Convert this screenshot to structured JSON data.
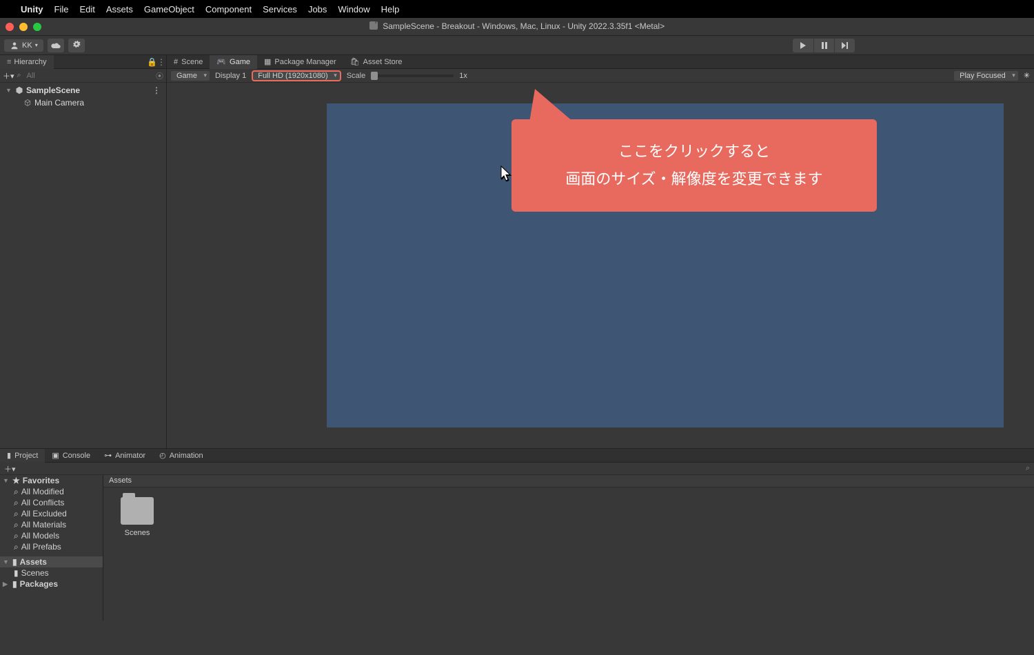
{
  "menubar": {
    "app": "Unity",
    "items": [
      "File",
      "Edit",
      "Assets",
      "GameObject",
      "Component",
      "Services",
      "Jobs",
      "Window",
      "Help"
    ]
  },
  "titlebar": {
    "title": "SampleScene - Breakout - Windows, Mac, Linux - Unity 2022.3.35f1 <Metal>"
  },
  "toolbar": {
    "account": "KK"
  },
  "hierarchy": {
    "tab_label": "Hierarchy",
    "search_placeholder": "All",
    "root": "SampleScene",
    "children": [
      "Main Camera"
    ]
  },
  "game_tabs": {
    "scene": "Scene",
    "game": "Game",
    "package": "Package Manager",
    "asset": "Asset Store"
  },
  "game_toolbar": {
    "mode": "Game",
    "display": "Display 1",
    "resolution": "Full HD (1920x1080)",
    "scale_label": "Scale",
    "scale_value": "1x",
    "play_focused": "Play Focused"
  },
  "callout": {
    "line1": "ここをクリックすると",
    "line2": "画面のサイズ・解像度を変更できます"
  },
  "bottom_tabs": {
    "project": "Project",
    "console": "Console",
    "animator": "Animator",
    "animation": "Animation"
  },
  "project": {
    "favorites": "Favorites",
    "fav_items": [
      "All Modified",
      "All Conflicts",
      "All Excluded",
      "All Materials",
      "All Models",
      "All Prefabs"
    ],
    "assets": "Assets",
    "asset_children": [
      "Scenes"
    ],
    "packages": "Packages",
    "crumb": "Assets",
    "folder_name": "Scenes"
  }
}
